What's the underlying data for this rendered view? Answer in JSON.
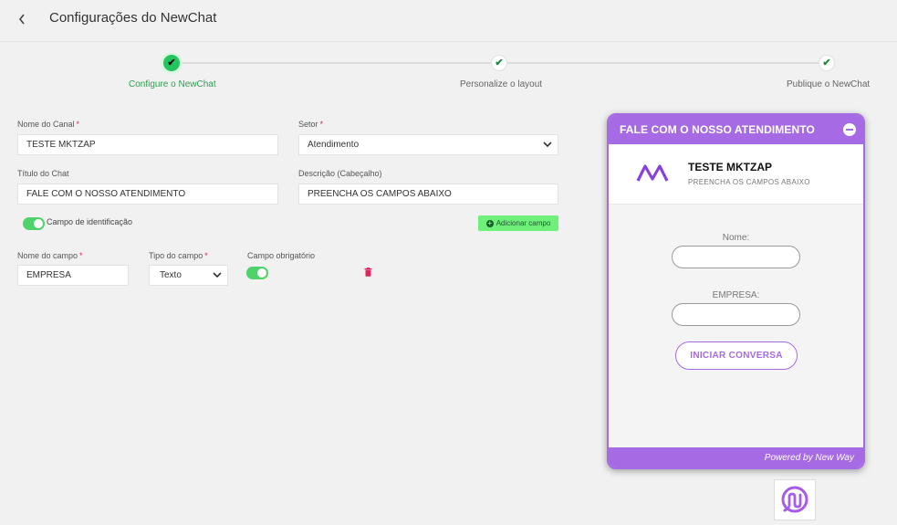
{
  "header": {
    "back_icon": "chevron-left-icon",
    "title": "Configurações do NewChat"
  },
  "stepper": {
    "steps": [
      {
        "label": "Configure o NewChat",
        "state": "active"
      },
      {
        "label": "Personalize o layout",
        "state": "done"
      },
      {
        "label": "Publique o NewChat",
        "state": "done"
      }
    ],
    "check_glyph": "✔"
  },
  "form": {
    "channel_name": {
      "label": "Nome do Canal",
      "required_mark": "*",
      "value": "TESTE MKTZAP"
    },
    "sector": {
      "label": "Setor",
      "required_mark": "*",
      "value": "Atendimento",
      "arrow": "⌄"
    },
    "chat_title": {
      "label": "Título do Chat",
      "value": "FALE COM O NOSSO ATENDIMENTO"
    },
    "description": {
      "label": "Descrição (Cabeçalho)",
      "value": "PREENCHA OS CAMPOS ABAIXO"
    },
    "identification_toggle": {
      "label": "Campo de identificação",
      "on": true
    },
    "add_field_button": {
      "label": "Adicionar campo",
      "plus": "+"
    },
    "custom_field": {
      "name_label": "Nome do campo",
      "name_required": "*",
      "name_value": "EMPRESA",
      "type_label": "Tipo do campo",
      "type_required": "*",
      "type_value": "Texto",
      "type_arrow": "⌄",
      "mandatory_label": "Campo obrigatório",
      "mandatory_on": true,
      "delete_icon": "trash-icon"
    }
  },
  "preview": {
    "header_title": "FALE COM O NOSSO ATENDIMENTO",
    "brand_name": "TESTE MKTZAP",
    "brand_sub": "PREENCHA OS CAMPOS ABAIXO",
    "fields": [
      {
        "label": "Nome:"
      },
      {
        "label": "EMPRESA:"
      }
    ],
    "button": "INICIAR CONVERSA",
    "footer": "Powered by New Way"
  },
  "colors": {
    "accent": "#a66ae4",
    "success": "#22c55e",
    "toggle": "#4fd26a",
    "danger": "#e0245e"
  }
}
